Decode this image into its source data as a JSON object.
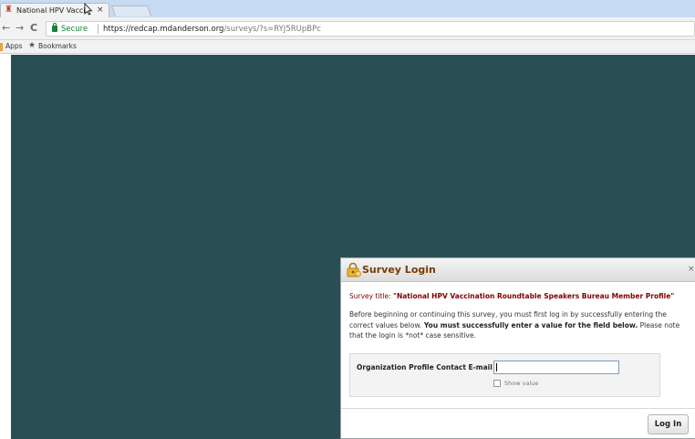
{
  "browser": {
    "tab_title": "National HPV Vaccinati",
    "tab_close": "×",
    "back_glyph": "←",
    "forward_glyph": "→",
    "reload_glyph": "C",
    "secure_label": "Secure",
    "url_host": "https://redcap.mdanderson.org",
    "url_path": "/surveys/?s=RYJ5RUpBPc",
    "bookmarks": [
      {
        "label": "Apps"
      },
      {
        "label": "Bookmarks"
      }
    ]
  },
  "dialog": {
    "title": "Survey Login",
    "close_glyph": "×",
    "survey_title_prefix": "Survey title: ",
    "survey_title": "\"National HPV Vaccination Roundtable Speakers Bureau Member Profile\"",
    "instructions_part1": "Before beginning or continuing this survey, you must first log in by successfully entering the correct values below.",
    "instructions_bold": " You must successfully enter a value for the field below.",
    "instructions_part2": " Please note that the login is *not* case sensitive.",
    "field_label": "Organization Profile Contact E-mail",
    "field_value": "",
    "show_value_label": "Show value",
    "show_value_checked": false,
    "login_button": "Log In"
  },
  "colors": {
    "background": "#294f55",
    "title": "#7a3a00",
    "survey_title": "#800000"
  }
}
